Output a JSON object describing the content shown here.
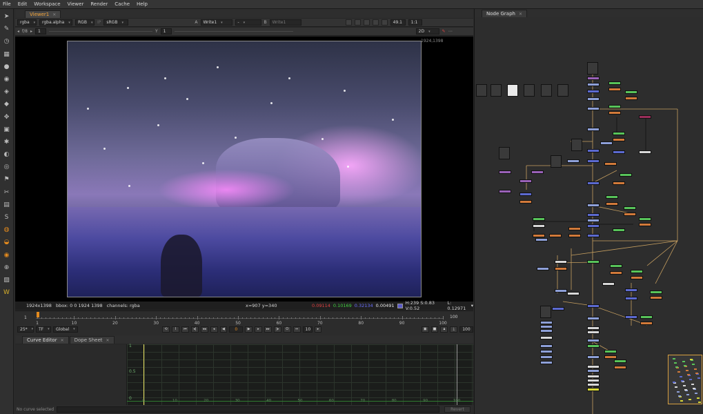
{
  "menu": [
    "File",
    "Edit",
    "Workspace",
    "Viewer",
    "Render",
    "Cache",
    "Help"
  ],
  "toolbar_icons": [
    "pointer-icon",
    "paint-icon",
    "time-icon",
    "channel-icon",
    "color-icon",
    "filter-icon",
    "keyer-icon",
    "merge-icon",
    "transform-icon",
    "3d-icon",
    "particles-icon",
    "deep-icon",
    "views-icon",
    "metadata-icon",
    "toolsets-icon",
    "other-icon",
    "s-icon",
    "furnace-icon",
    "flame-icon",
    "swirl-icon",
    "target-icon",
    "image-icon",
    "w-icon"
  ],
  "viewer": {
    "tab": "Viewer1",
    "row1": {
      "channels": "rgba",
      "alpha": "rgba.alpha",
      "colorspace": "RGB",
      "ip": "IP",
      "lut": "sRGB",
      "a_label": "A",
      "a_input": "Write1",
      "dash": "-",
      "b_label": "B",
      "b_input": "Write1",
      "zoom": "49.1",
      "ratio": "1:1"
    },
    "row2": {
      "fstop": "f/8",
      "gain": "1",
      "y_label": "Y",
      "gamma": "1",
      "mode": "2D"
    },
    "resolution_label": "1924,1398",
    "info": {
      "format": "1924x1398",
      "bbox": "bbox: 0 0 1924 1398",
      "channels": "channels: rgba",
      "coords": "x=907 y=340",
      "r": "0.09114",
      "g": "0.10169",
      "b": "0.32134",
      "a": "0.00491",
      "hsv": "H:239 S:0.83 V:0.52",
      "lum": "L: 0.12971"
    },
    "timeline": {
      "start": "1",
      "ticks": [
        "1",
        "10",
        "20",
        "30",
        "40",
        "50",
        "60",
        "70",
        "80",
        "90",
        "100"
      ],
      "end": "100",
      "fps": "25*",
      "tf": "TF",
      "scope": "Global",
      "current_frame": "0",
      "step": "10",
      "end_field": "100"
    }
  },
  "curve_editor": {
    "tabs": [
      "Curve Editor",
      "Dope Sheet"
    ],
    "y_labels": [
      "1",
      "0.5",
      "0"
    ],
    "x_labels": [
      "0",
      "10",
      "20",
      "30",
      "40",
      "50",
      "60",
      "70",
      "80",
      "90",
      "100"
    ],
    "status": "No curve selected",
    "revert": "Revert"
  },
  "node_graph": {
    "tab": "Node Graph"
  }
}
